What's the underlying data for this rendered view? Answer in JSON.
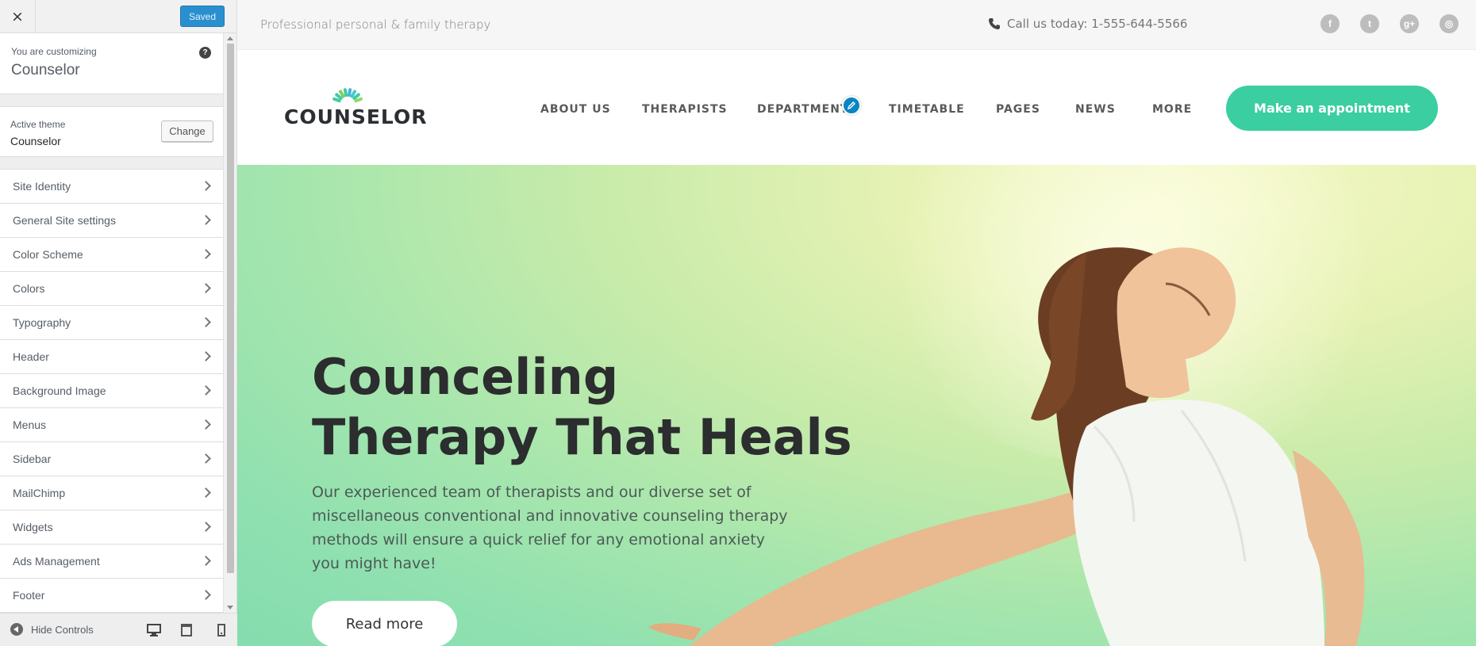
{
  "customizer": {
    "close_label": "×",
    "saved_label": "Saved",
    "info": {
      "customizing_label": "You are customizing",
      "site_name": "Counselor",
      "help_icon": "?"
    },
    "theme": {
      "active_label": "Active theme",
      "theme_name": "Counselor",
      "change_label": "Change"
    },
    "sections": [
      {
        "label": "Site Identity"
      },
      {
        "label": "General Site settings"
      },
      {
        "label": "Color Scheme"
      },
      {
        "label": "Colors"
      },
      {
        "label": "Typography"
      },
      {
        "label": "Header"
      },
      {
        "label": "Background Image"
      },
      {
        "label": "Menus"
      },
      {
        "label": "Sidebar"
      },
      {
        "label": "MailChimp"
      },
      {
        "label": "Widgets"
      },
      {
        "label": "Ads Management"
      },
      {
        "label": "Footer"
      }
    ],
    "footer": {
      "hide_controls_label": "Hide Controls"
    }
  },
  "site": {
    "tagline": "Professional personal & family therapy",
    "phone_text": "Call us today: 1-555-644-5566",
    "social": [
      "facebook-icon",
      "twitter-icon",
      "googleplus-icon",
      "instagram-icon"
    ],
    "logo_text": "COUNSELOR",
    "nav": {
      "about": "ABOUT US",
      "therapists": "THERAPISTS",
      "department": "DEPARTMENT",
      "timetable": "TIMETABLE",
      "pages": "PAGES",
      "news": "NEWS",
      "more": "MORE"
    },
    "cta_label": "Make an appointment",
    "hero": {
      "title_line1": "Counceling",
      "title_line2": "Therapy That Heals",
      "text": "Our experienced team of therapists and our diverse set of miscellaneous conventional and innovative counseling therapy methods will ensure a quick relief for any emotional anxiety you might have!",
      "button_label": "Read more"
    },
    "colors": {
      "accent": "#3bcea0",
      "edit_blue": "#0a85c4",
      "saved_blue": "#2a8fcf"
    }
  }
}
